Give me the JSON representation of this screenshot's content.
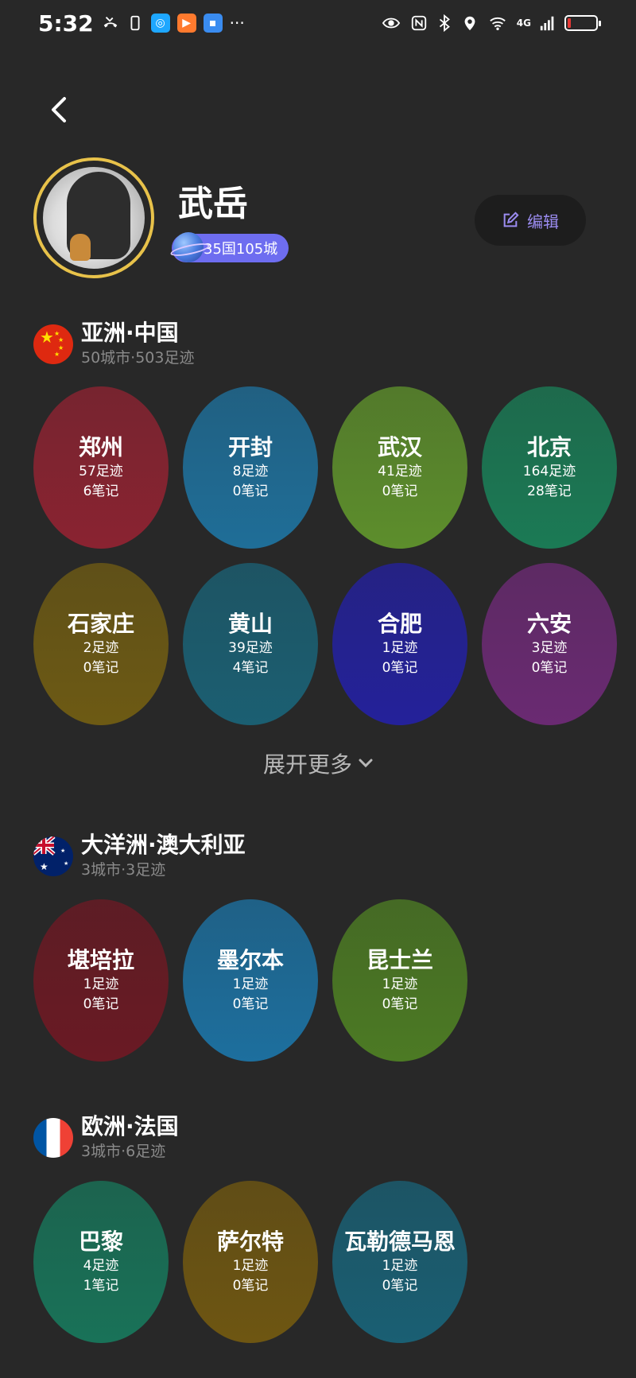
{
  "status_bar": {
    "time": "5:32",
    "network": "4G",
    "icons": [
      "missed-call-icon",
      "phone-icon",
      "search-app-icon",
      "video-app-icon",
      "app-icon",
      "more-icon",
      "eye-icon",
      "nfc-icon",
      "bluetooth-icon",
      "location-icon",
      "wifi-icon",
      "signal-icon",
      "battery-icon"
    ],
    "more": "···"
  },
  "profile": {
    "name": "武岳",
    "badge": "35国105城",
    "edit_label": "编辑"
  },
  "colors": {
    "background": "#282828",
    "avatar_ring": "#e8c24a",
    "badge": "#6e6df0",
    "edit_accent": "#9b8cf0"
  },
  "sections": [
    {
      "name": "亚洲·中国",
      "stats": "50城市·503足迹",
      "flag": "china-flag",
      "cities": [
        {
          "name": "郑州",
          "footprints": "57足迹",
          "notes": "6笔记",
          "color": "#8a2331"
        },
        {
          "name": "开封",
          "footprints": "8足迹",
          "notes": "0笔记",
          "color": "#1f6e98"
        },
        {
          "name": "武汉",
          "footprints": "41足迹",
          "notes": "0笔记",
          "color": "#5d8e2c"
        },
        {
          "name": "北京",
          "footprints": "164足迹",
          "notes": "28笔记",
          "color": "#1b7a55"
        },
        {
          "name": "石家庄",
          "footprints": "2足迹",
          "notes": "0笔记",
          "color": "#6d5a14"
        },
        {
          "name": "黄山",
          "footprints": "39足迹",
          "notes": "4笔记",
          "color": "#1b5f72"
        },
        {
          "name": "合肥",
          "footprints": "1足迹",
          "notes": "0笔记",
          "color": "#24219a"
        },
        {
          "name": "六安",
          "footprints": "3足迹",
          "notes": "0笔记",
          "color": "#6a2a72"
        }
      ]
    },
    {
      "name": "大洋洲·澳大利亚",
      "stats": "3城市·3足迹",
      "flag": "australia-flag",
      "cities": [
        {
          "name": "堪培拉",
          "footprints": "1足迹",
          "notes": "0笔记",
          "color": "#6a1a24"
        },
        {
          "name": "墨尔本",
          "footprints": "1足迹",
          "notes": "0笔记",
          "color": "#1d6f9e"
        },
        {
          "name": "昆士兰",
          "footprints": "1足迹",
          "notes": "0笔记",
          "color": "#4c7a24"
        }
      ]
    },
    {
      "name": "欧洲·法国",
      "stats": "3城市·6足迹",
      "flag": "france-flag",
      "cities": [
        {
          "name": "巴黎",
          "footprints": "4足迹",
          "notes": "1笔记",
          "color": "#197258"
        },
        {
          "name": "萨尔特",
          "footprints": "1足迹",
          "notes": "0笔记",
          "color": "#6e5612"
        },
        {
          "name": "瓦勒德马恩",
          "footprints": "1足迹",
          "notes": "0笔记",
          "color": "#1a5f73"
        }
      ]
    }
  ],
  "expand_label": "展开更多"
}
